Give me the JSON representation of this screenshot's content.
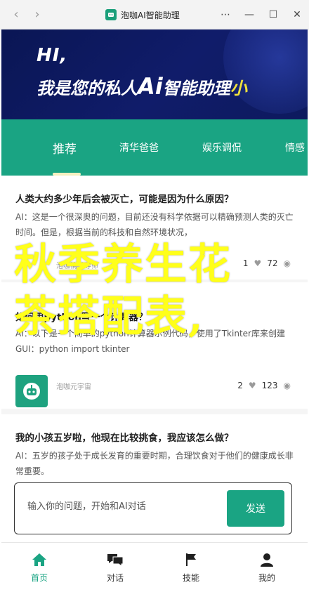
{
  "window": {
    "title": "泡咖AI智能助理",
    "back_icon": "chevron-left-icon",
    "forward_icon": "chevron-right-icon",
    "more_icon": "more-dots-icon",
    "minimize_icon": "minimize-icon",
    "maximize_icon": "maximize-icon",
    "close_icon": "close-icon"
  },
  "banner": {
    "line1": "HI,",
    "line2_prefix": "我是您的私人",
    "line2_ai": "Ai",
    "line2_suffix": "智能助理",
    "line2_tail": "小"
  },
  "tabs": [
    {
      "label": "推荐",
      "active": true
    },
    {
      "label": "清华爸爸",
      "active": false
    },
    {
      "label": "娱乐调侃",
      "active": false
    },
    {
      "label": "情感",
      "active": false
    }
  ],
  "feed": [
    {
      "title": "人类大约多少年后会被灭亡，可能是因为什么原因？",
      "body": "AI：这是一个很深奥的问题，目前还没有科学依据可以精确预测人类的灭亡时间。但是，根据当前的科技和自然环境状况，",
      "author": "泡咖情感导师",
      "likes": "1",
      "views": "72"
    },
    {
      "title": "如何用python写一个计算器？",
      "body": "AI：以下是一个简单的python计算器示例代码，使用了Tkinter库来创建GUI：python import tkinter",
      "author": "泡咖元宇宙",
      "likes": "2",
      "views": "123"
    },
    {
      "title": "我的小孩五岁啦，他现在比较挑食，我应该怎么做？",
      "body": "AI：五岁的孩子处于成长发育的重要时期，合理饮食对于他们的健康成长非常重要。",
      "author": "",
      "likes": "",
      "views": ""
    }
  ],
  "overlay": {
    "line1": "秋季养生花",
    "line2": "茶搭配表,"
  },
  "input": {
    "placeholder": "输入你的问题，开始和AI对话",
    "send_label": "发送"
  },
  "bottom_nav": [
    {
      "label": "首页",
      "icon": "home-icon",
      "active": true
    },
    {
      "label": "对话",
      "icon": "chat-icon",
      "active": false
    },
    {
      "label": "技能",
      "icon": "flag-icon",
      "active": false
    },
    {
      "label": "我的",
      "icon": "user-icon",
      "active": false
    }
  ],
  "colors": {
    "accent": "#1aa483",
    "banner_bg": "#0a1654",
    "overlay_text": "#ffff1a"
  }
}
